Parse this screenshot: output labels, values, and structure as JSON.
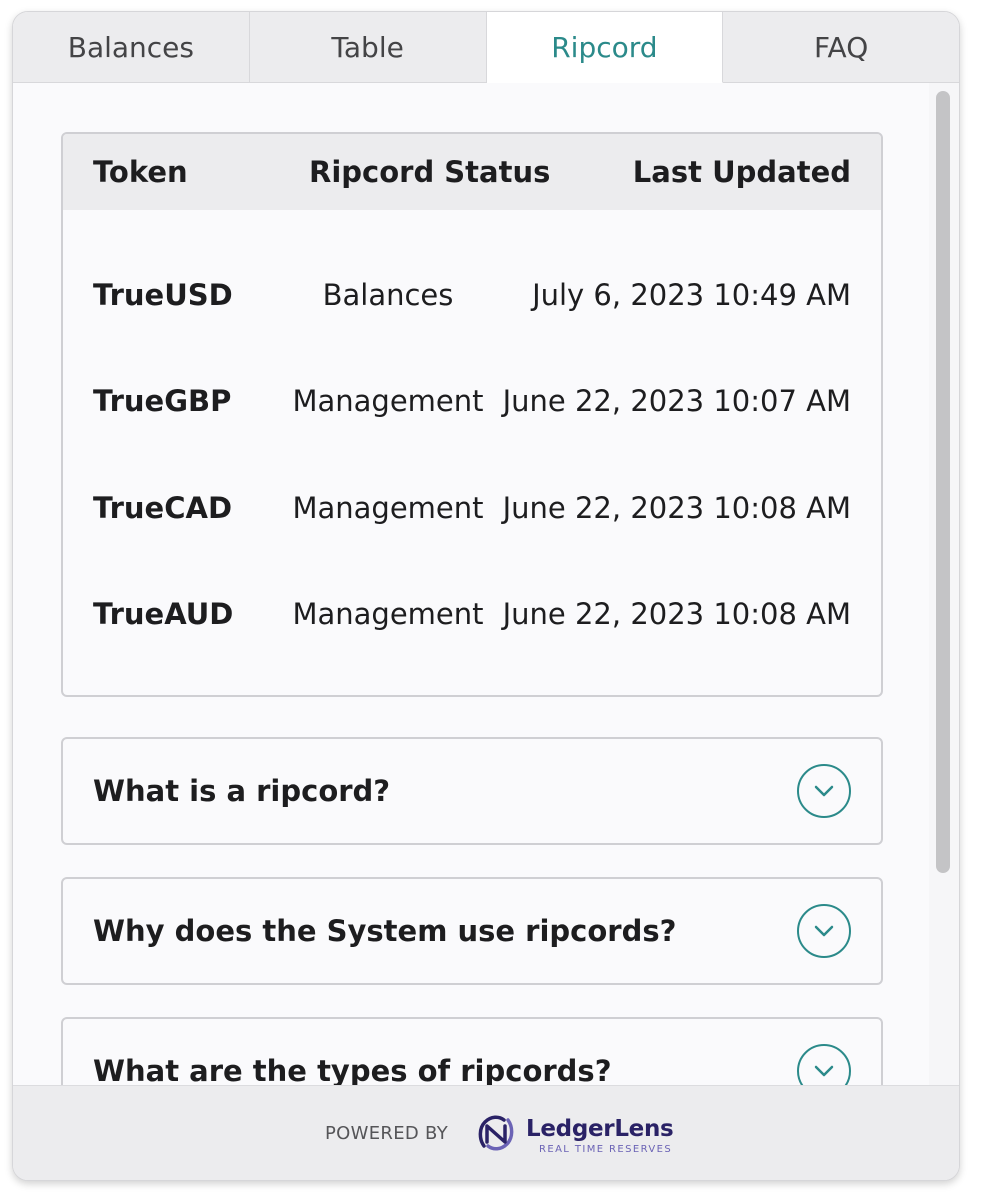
{
  "tabs": [
    {
      "label": "Balances",
      "active": false
    },
    {
      "label": "Table",
      "active": false
    },
    {
      "label": "Ripcord",
      "active": true
    },
    {
      "label": "FAQ",
      "active": false
    }
  ],
  "ripcord_table": {
    "headers": {
      "token": "Token",
      "status": "Ripcord Status",
      "updated": "Last Updated"
    },
    "rows": [
      {
        "token": "TrueUSD",
        "status": "Balances",
        "updated": "July 6, 2023 10:49 AM"
      },
      {
        "token": "TrueGBP",
        "status": "Management",
        "updated": "June 22, 2023 10:07 AM"
      },
      {
        "token": "TrueCAD",
        "status": "Management",
        "updated": "June 22, 2023 10:08 AM"
      },
      {
        "token": "TrueAUD",
        "status": "Management",
        "updated": "June 22, 2023 10:08 AM"
      }
    ]
  },
  "faq": [
    {
      "question": "What is a ripcord?"
    },
    {
      "question": "Why does the System use ripcords?"
    },
    {
      "question": "What are the types of ripcords?"
    }
  ],
  "footer": {
    "powered_by": "POWERED BY",
    "brand_name": "LedgerLens",
    "brand_tagline": "REAL TIME RESERVES",
    "logo_icon": "ledgerlens-logo"
  },
  "colors": {
    "accent": "#2b8a8a",
    "brand": "#2a2266"
  },
  "icons": {
    "faq_toggle": "chevron-down-icon"
  }
}
